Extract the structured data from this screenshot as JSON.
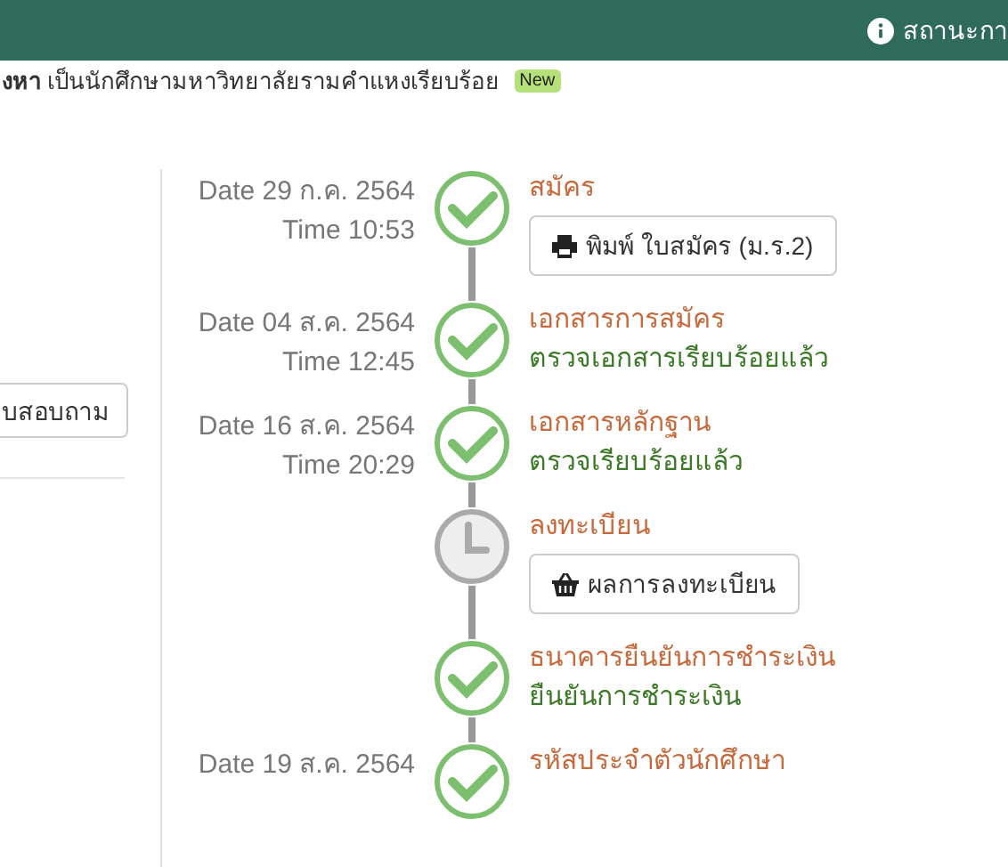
{
  "header": {
    "status_link": "สถานะกา"
  },
  "notice": {
    "text": "**งหา** เป็นนักศึกษามหาวิทยาลัยรามคำแหงเรียบร้อย",
    "badge": "New"
  },
  "side": {
    "button": "บสอบถาม"
  },
  "timeline": [
    {
      "kind": "done",
      "date": "Date 29 ก.ค. 2564",
      "time": "Time 10:53",
      "title": "สมัคร",
      "button": {
        "kind": "printer",
        "label": "พิมพ์ ใบสมัคร (ม.ร.2)"
      }
    },
    {
      "kind": "done",
      "date": "Date 04 ส.ค. 2564",
      "time": "Time 12:45",
      "title": "เอกสารการสมัคร",
      "status": "ตรวจเอกสารเรียบร้อยแล้ว"
    },
    {
      "kind": "done",
      "date": "Date 16 ส.ค. 2564",
      "time": "Time 20:29",
      "title": "เอกสารหลักฐาน",
      "status": "ตรวจเรียบร้อยแล้ว"
    },
    {
      "kind": "pending",
      "title": "ลงทะเบียน",
      "button": {
        "kind": "basket",
        "label": "ผลการลงทะเบียน"
      }
    },
    {
      "kind": "done",
      "title": "ธนาคารยืนยันการชำระเงิน",
      "status": "ยืนยันการชำระเงิน"
    },
    {
      "kind": "done",
      "date": "Date 19 ส.ค. 2564",
      "title": "รหัสประจำตัวนักศึกษา"
    }
  ]
}
